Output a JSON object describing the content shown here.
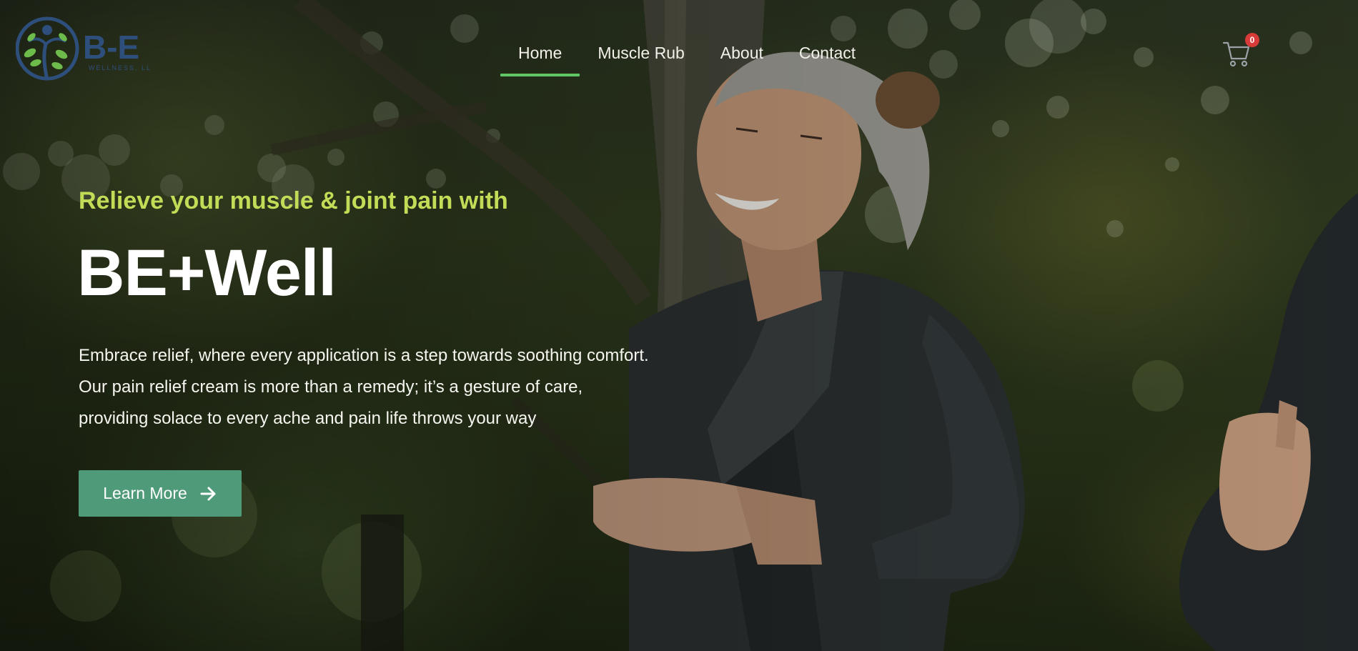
{
  "brand": {
    "logo_text": "B-E",
    "logo_subtext": "WELLNESS, LLC"
  },
  "nav": {
    "items": [
      {
        "label": "Home",
        "active": true
      },
      {
        "label": "Muscle Rub",
        "active": false
      },
      {
        "label": "About",
        "active": false
      },
      {
        "label": "Contact",
        "active": false
      }
    ]
  },
  "cart": {
    "icon": "shopping-cart-icon",
    "count": "0"
  },
  "hero": {
    "tagline": "Relieve your muscle & joint pain with",
    "headline": "BE+Well",
    "description": "Embrace relief, where every application is a step towards soothing comfort. Our pain relief cream is more than a remedy; it’s a gesture of care, providing solace to every ache and pain life throws your way",
    "cta_label": "Learn More",
    "cta_icon": "arrow-right-icon"
  },
  "colors": {
    "accent_green": "#5fc766",
    "tagline": "#c3dc58",
    "button": "#4f9a78",
    "badge": "#d93b3b"
  }
}
